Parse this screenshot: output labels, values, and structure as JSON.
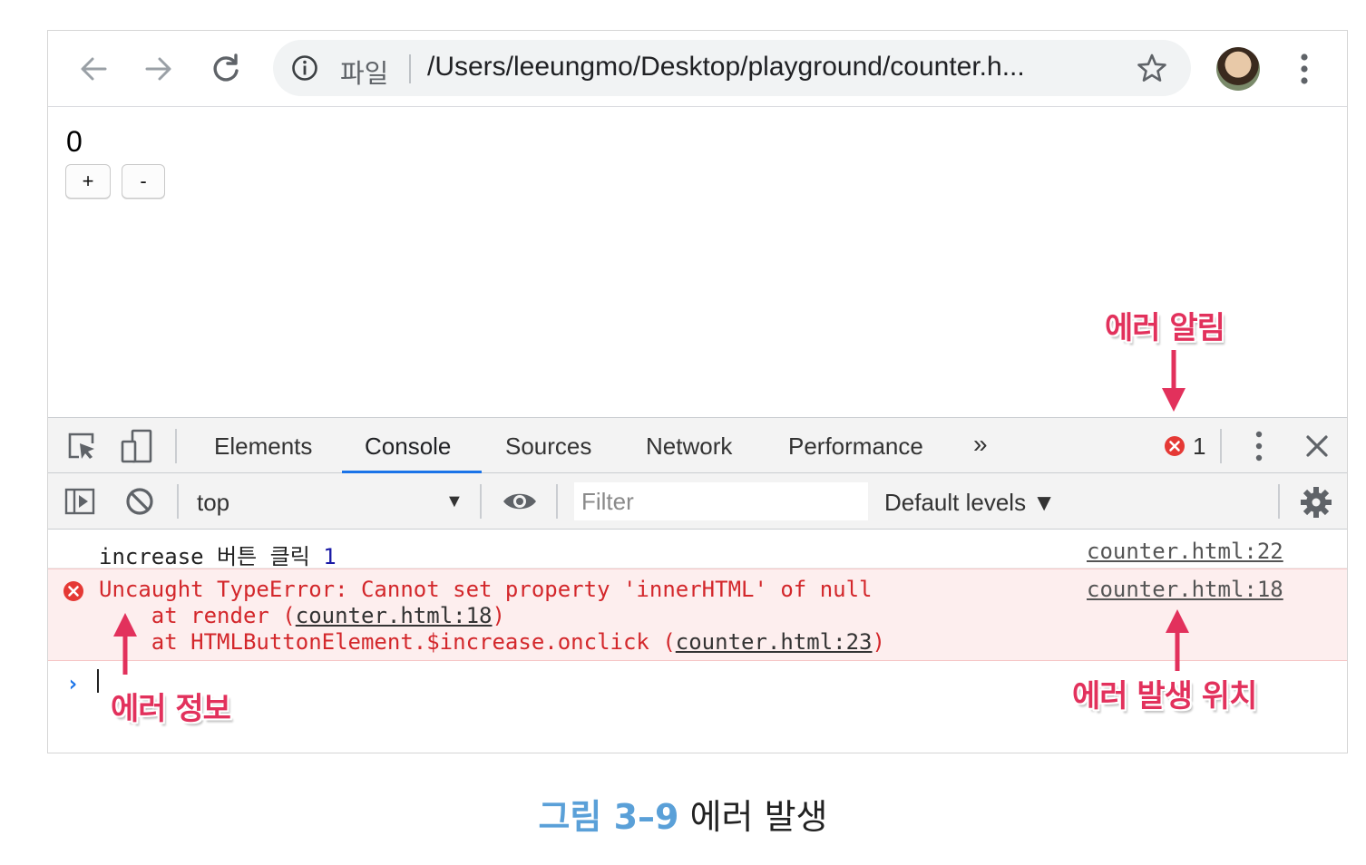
{
  "browser": {
    "nav": {
      "back_icon": "arrow-left-icon",
      "forward_icon": "arrow-right-icon",
      "reload_icon": "reload-icon"
    },
    "omnibox": {
      "info_icon": "info-icon",
      "scheme_label": "파일",
      "url": "/Users/leeungmo/Desktop/playground/counter.h...",
      "star_icon": "star-icon"
    },
    "profile_icon": "avatar",
    "menu_icon": "kebab-menu-icon"
  },
  "page": {
    "counter_value": "0",
    "increase_label": "+",
    "decrease_label": "-"
  },
  "devtools": {
    "tabs": [
      "Elements",
      "Console",
      "Sources",
      "Network",
      "Performance"
    ],
    "active_tab": "Console",
    "more_tabs": "»",
    "error_count": "1",
    "toolbar": {
      "context": "top",
      "filter_placeholder": "Filter",
      "levels": "Default levels ▼"
    },
    "console": {
      "log": {
        "text": "increase 버튼 클릭",
        "count": "1",
        "source": "counter.html:22"
      },
      "error": {
        "message": "Uncaught TypeError: Cannot set property 'innerHTML' of null",
        "stack1_prefix": "    at render (",
        "stack1_link": "counter.html:18",
        "stack1_suffix": ")",
        "stack2_prefix": "    at HTMLButtonElement.$increase.onclick (",
        "stack2_link": "counter.html:23",
        "stack2_suffix": ")",
        "source": "counter.html:18"
      },
      "prompt": "›"
    }
  },
  "annotations": {
    "error_alert": "에러 알림",
    "error_info": "에러 정보",
    "error_location": "에러 발생 위치",
    "color": "#e2315c"
  },
  "caption": {
    "number": "그림 3–9",
    "title": "에러 발생"
  }
}
